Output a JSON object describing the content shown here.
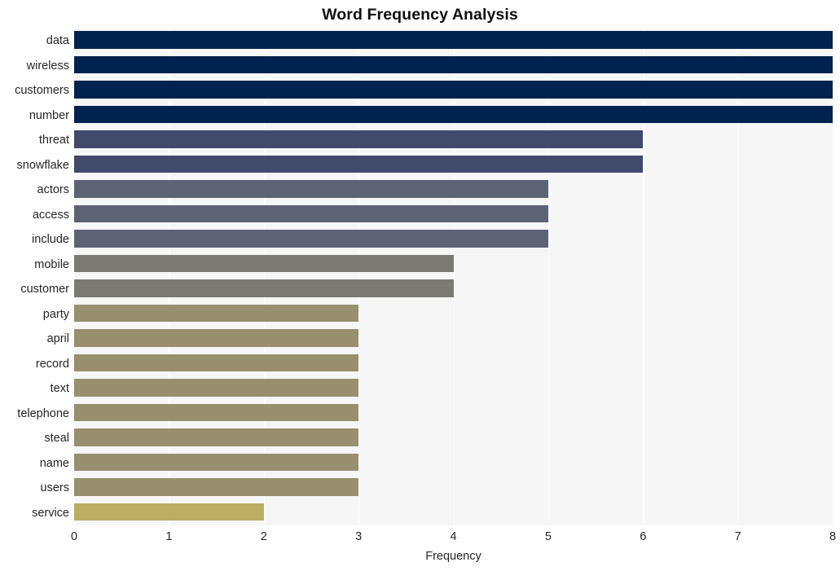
{
  "chart_data": {
    "type": "bar",
    "orientation": "horizontal",
    "title": "Word Frequency Analysis",
    "xlabel": "Frequency",
    "ylabel": "",
    "xlim": [
      0,
      8
    ],
    "xticks": [
      0,
      1,
      2,
      3,
      4,
      5,
      6,
      7,
      8
    ],
    "xtick_labels": [
      "0",
      "1",
      "2",
      "3",
      "4",
      "5",
      "6",
      "7",
      "8"
    ],
    "grid": true,
    "grid_axis": "x",
    "legend": false,
    "categories": [
      "data",
      "wireless",
      "customers",
      "number",
      "threat",
      "snowflake",
      "actors",
      "access",
      "include",
      "mobile",
      "customer",
      "party",
      "april",
      "record",
      "text",
      "telephone",
      "steal",
      "name",
      "users",
      "service"
    ],
    "values": [
      8,
      8,
      8,
      8,
      6,
      6,
      5,
      5,
      5,
      4,
      4,
      3,
      3,
      3,
      3,
      3,
      3,
      3,
      3,
      2
    ],
    "bar_colors": [
      "#00224e",
      "#00224e",
      "#00224e",
      "#00224e",
      "#414a6b",
      "#414a6b",
      "#5d6274",
      "#5d6274",
      "#5d6274",
      "#7b7a73",
      "#7b7a73",
      "#988f6f",
      "#988f6f",
      "#988f6f",
      "#988f6f",
      "#988f6f",
      "#988f6f",
      "#988f6f",
      "#988f6f",
      "#bcad63"
    ],
    "colormap": "cividis",
    "plot_background": "#f6f6f7",
    "figure_background": "#ffffff",
    "gridline_color": "#ffffff",
    "text_color": "#262626"
  }
}
